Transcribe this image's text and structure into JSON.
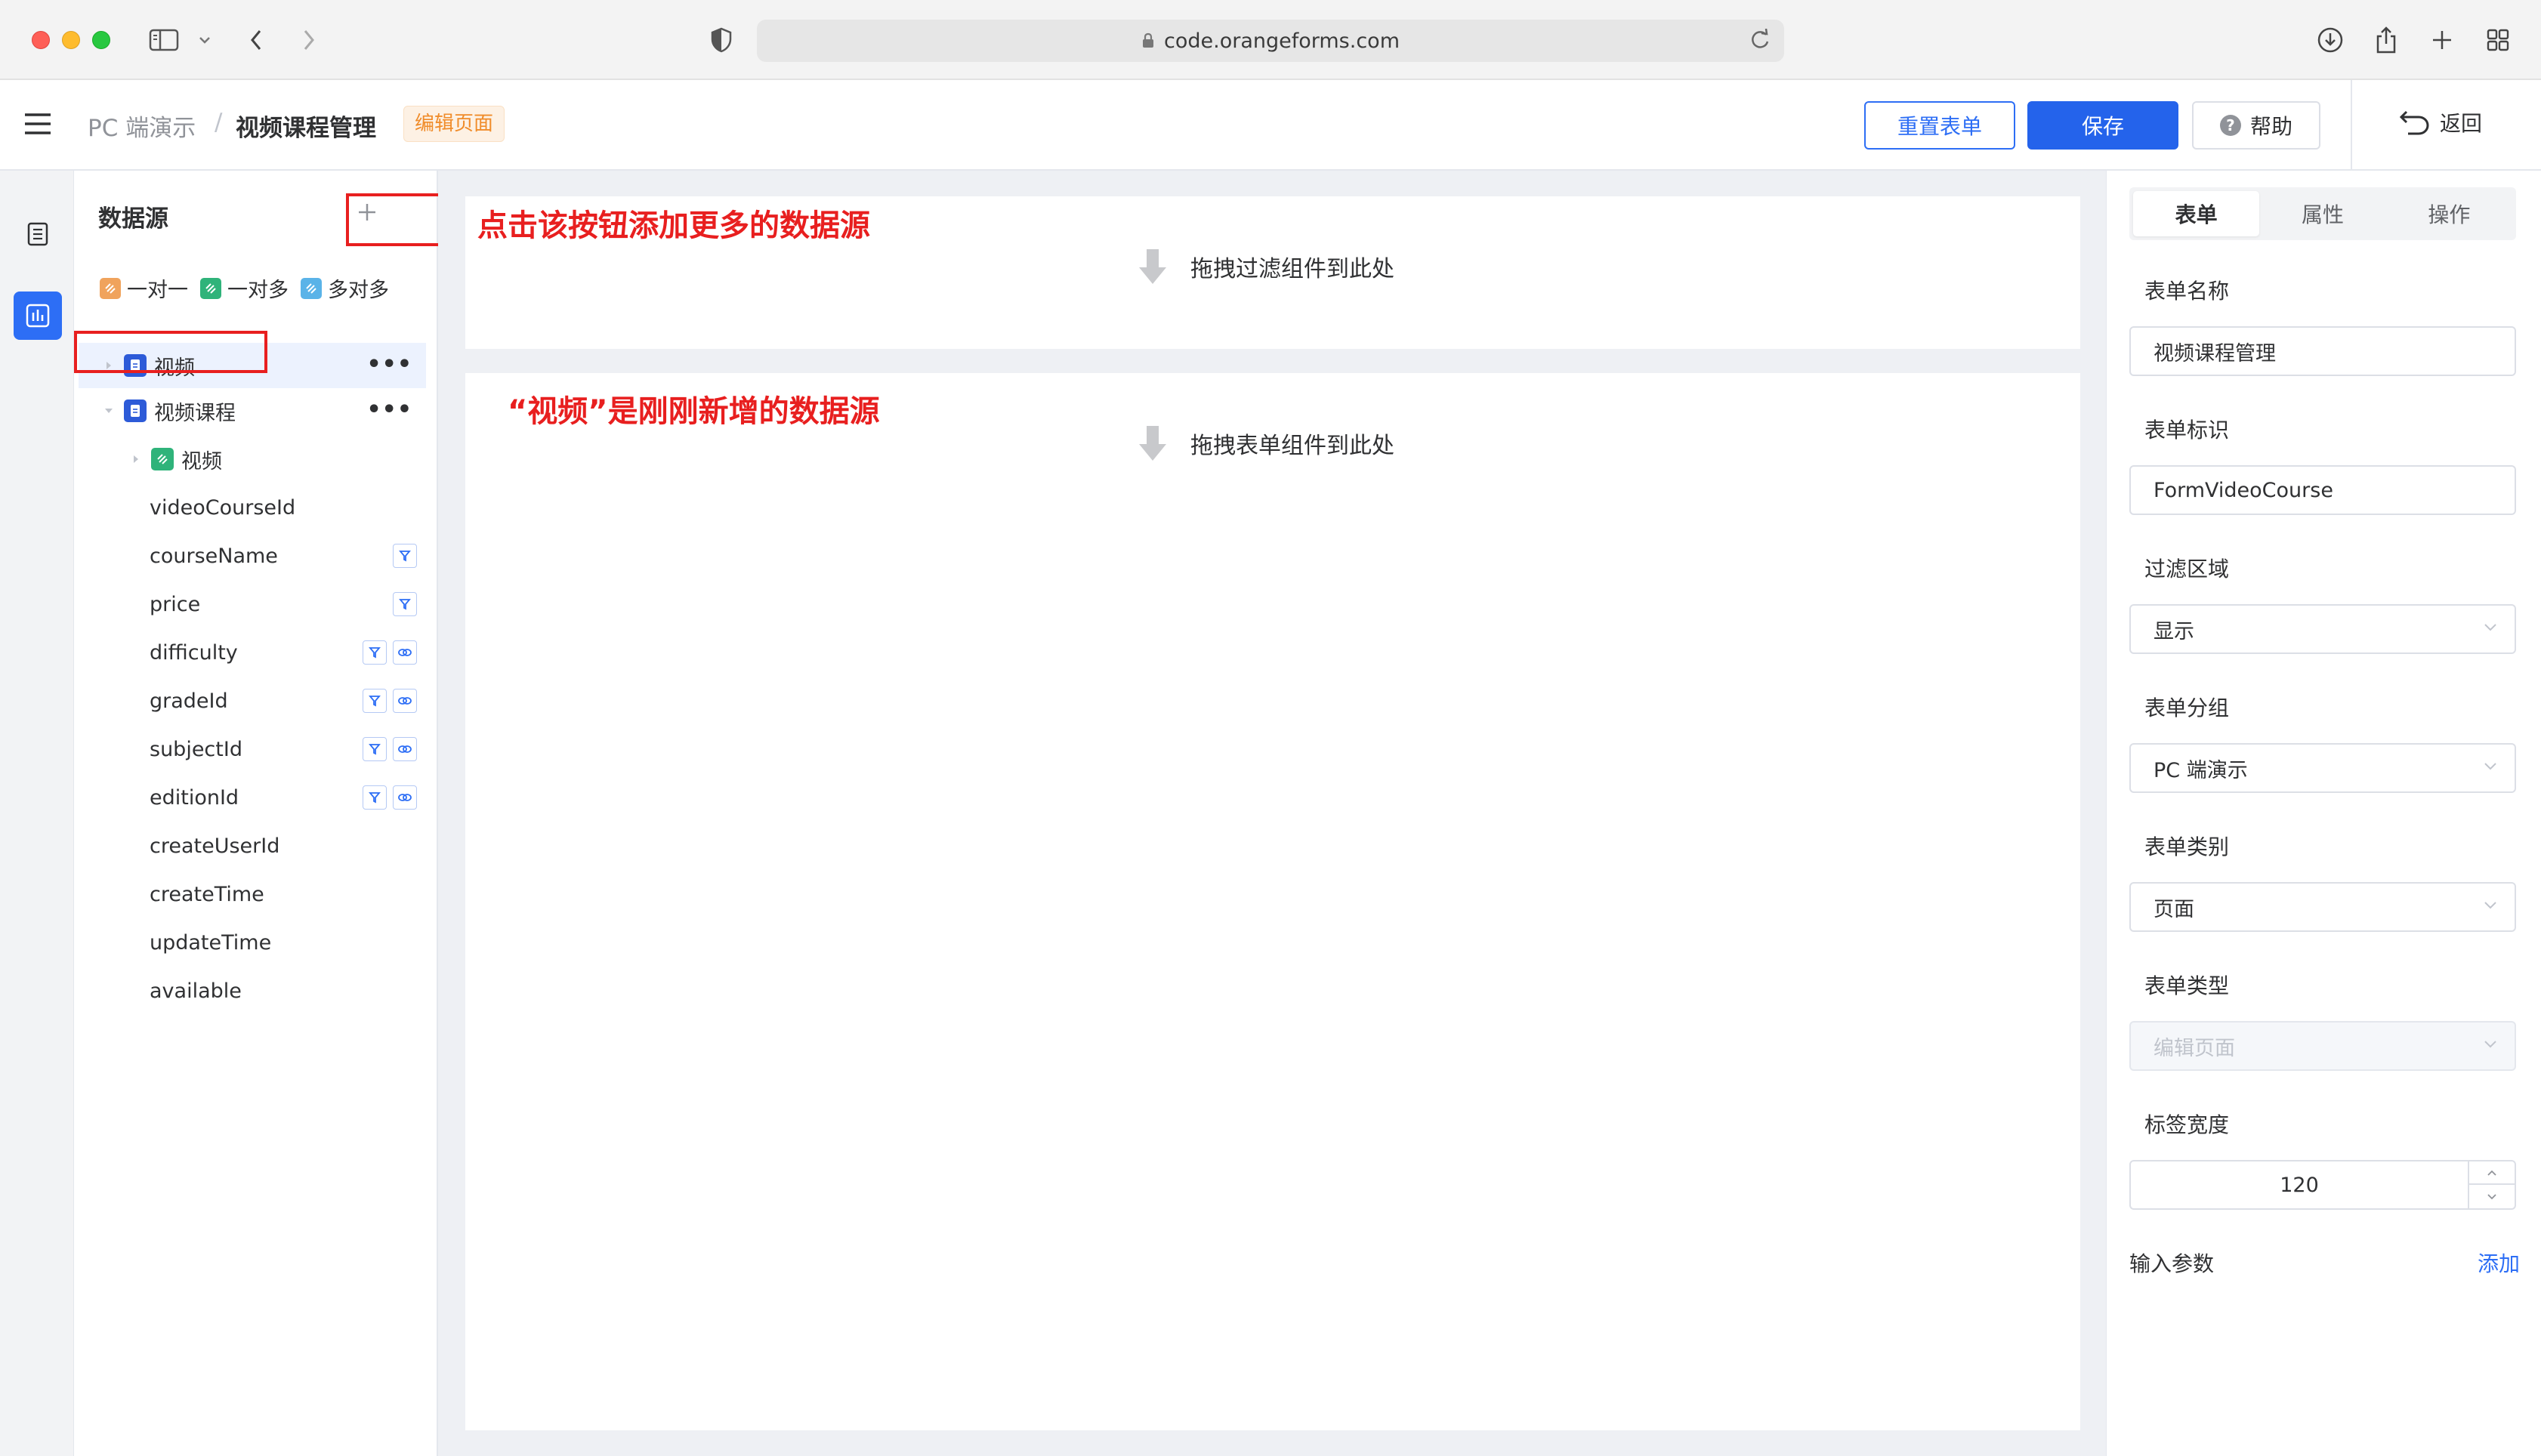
{
  "browser": {
    "url": "code.orangeforms.com"
  },
  "header": {
    "breadcrumb_parent": "PC 端演示",
    "breadcrumb_separator": "/",
    "breadcrumb_current": "视频课程管理",
    "page_tag": "编辑页面",
    "reset_label": "重置表单",
    "save_label": "保存",
    "help_label": "帮助",
    "help_icon_glyph": "?",
    "back_label": "返回"
  },
  "datasource": {
    "title": "数据源",
    "legend": [
      {
        "label": "一对一",
        "color": "#f0a35c"
      },
      {
        "label": "一对多",
        "color": "#2fb37a"
      },
      {
        "label": "多对多",
        "color": "#5ab3e8"
      }
    ],
    "tree": [
      {
        "label": "视频",
        "type": "table",
        "selected": true,
        "more": "•••"
      },
      {
        "label": "视频课程",
        "type": "table",
        "expanded": true,
        "more": "•••"
      },
      {
        "label": "视频",
        "type": "relation-one-to-many"
      }
    ],
    "fields": [
      {
        "name": "videoCourseId",
        "filter": false,
        "dict": false
      },
      {
        "name": "courseName",
        "filter": true,
        "dict": false
      },
      {
        "name": "price",
        "filter": true,
        "dict": false
      },
      {
        "name": "difficulty",
        "filter": true,
        "dict": true
      },
      {
        "name": "gradeId",
        "filter": true,
        "dict": true
      },
      {
        "name": "subjectId",
        "filter": true,
        "dict": true
      },
      {
        "name": "editionId",
        "filter": true,
        "dict": true
      },
      {
        "name": "createUserId",
        "filter": false,
        "dict": false
      },
      {
        "name": "createTime",
        "filter": false,
        "dict": false
      },
      {
        "name": "updateTime",
        "filter": false,
        "dict": false
      },
      {
        "name": "available",
        "filter": false,
        "dict": false
      }
    ]
  },
  "canvas": {
    "filter_hint": "拖拽过滤组件到此处",
    "form_hint": "拖拽表单组件到此处",
    "annotation_add": "点击该按钮添加更多的数据源",
    "annotation_new": "“视频”是刚刚新增的数据源"
  },
  "props": {
    "tabs": [
      "表单",
      "属性",
      "操作"
    ],
    "active_tab": "表单",
    "form_name_label": "表单名称",
    "form_name_value": "视频课程管理",
    "form_id_label": "表单标识",
    "form_id_value": "FormVideoCourse",
    "filter_area_label": "过滤区域",
    "filter_area_value": "显示",
    "form_group_label": "表单分组",
    "form_group_value": "PC 端演示",
    "form_category_label": "表单类别",
    "form_category_value": "页面",
    "form_type_label": "表单类型",
    "form_type_value": "编辑页面",
    "label_width_label": "标签宽度",
    "label_width_value": "120",
    "input_params_label": "输入参数",
    "input_params_add": "添加"
  },
  "colors": {
    "primary": "#2d6ef5",
    "annotation_red": "#e81f1f",
    "table_icon": "#2d5bd8",
    "relation_icon": "#2fb37a"
  }
}
